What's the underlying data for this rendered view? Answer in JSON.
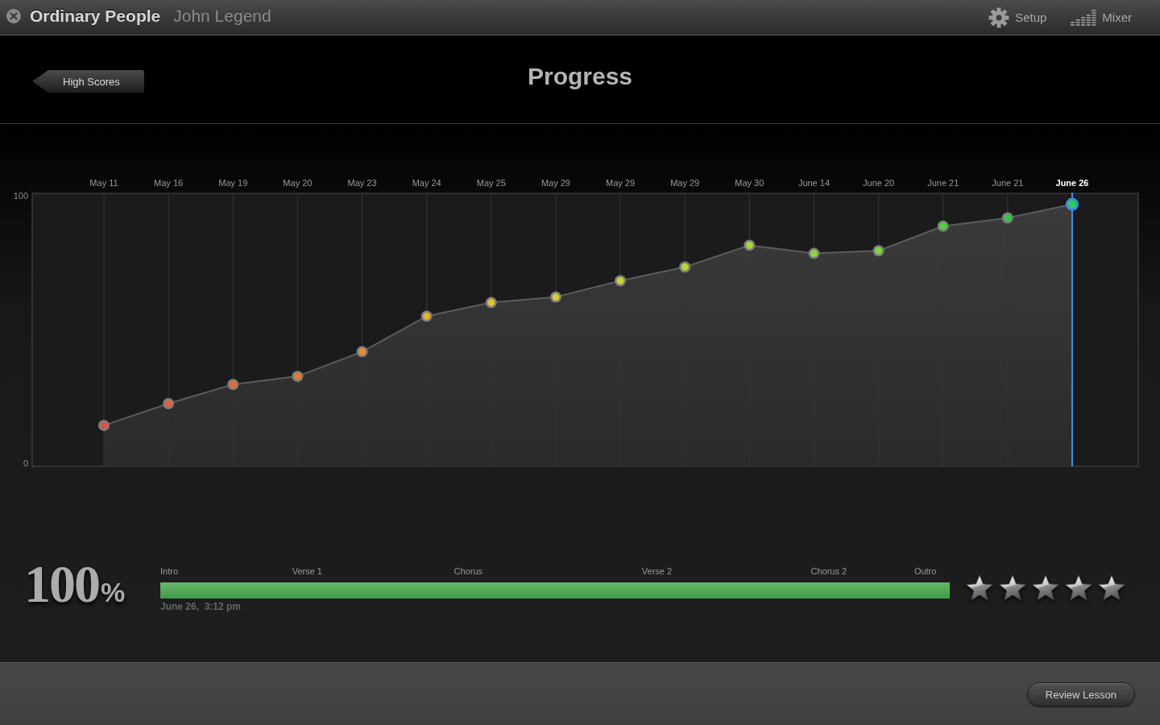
{
  "title_bar": {
    "song": "Ordinary People",
    "artist": "John Legend",
    "tools": [
      {
        "kind": "gear",
        "label": "Setup"
      },
      {
        "kind": "mixer",
        "label": "Mixer"
      }
    ]
  },
  "header": {
    "back_button": "High Scores",
    "title": "Progress"
  },
  "chart": {
    "chart_data": [
      {
        "type": "area",
        "categories": [
          "May 11",
          "May 16",
          "May 19",
          "May 20",
          "May 23",
          "May 24",
          "May 25",
          "May 29",
          "May 29",
          "May 29",
          "May 30",
          "June 14",
          "June 20",
          "June 21",
          "June 21",
          "June 26"
        ],
        "values": [
          15,
          23,
          30,
          33,
          42,
          55,
          60,
          62,
          68,
          73,
          81,
          78,
          79,
          88,
          91,
          96
        ],
        "colors": [
          "#e0504a",
          "#e0603c",
          "#e36d32",
          "#e57a2e",
          "#e8902c",
          "#e8b22c",
          "#e2c22e",
          "#d9cc2e",
          "#c9d52e",
          "#b5d830",
          "#a0d832",
          "#8cd834",
          "#7ed836",
          "#4fd03c",
          "#2fcb40",
          "#2ccf50"
        ],
        "ylim": [
          0,
          100
        ],
        "yticks": [
          0,
          100
        ],
        "grid": true,
        "marker": "circle",
        "ref_lines": [
          {
            "axis": "x",
            "value": "June 26",
            "color": "#3a8ee6",
            "line_style": "solid"
          }
        ]
      }
    ]
  },
  "result": {
    "score": "100",
    "unit": "%",
    "sections": [
      "Intro",
      "Verse 1",
      "Chorus",
      "Verse 2",
      "Chorus 2",
      "Outro"
    ],
    "level": 1,
    "date": "June 26,  3:12 pm",
    "stars": 5
  },
  "footer": {
    "review_button": "Review Lesson"
  }
}
